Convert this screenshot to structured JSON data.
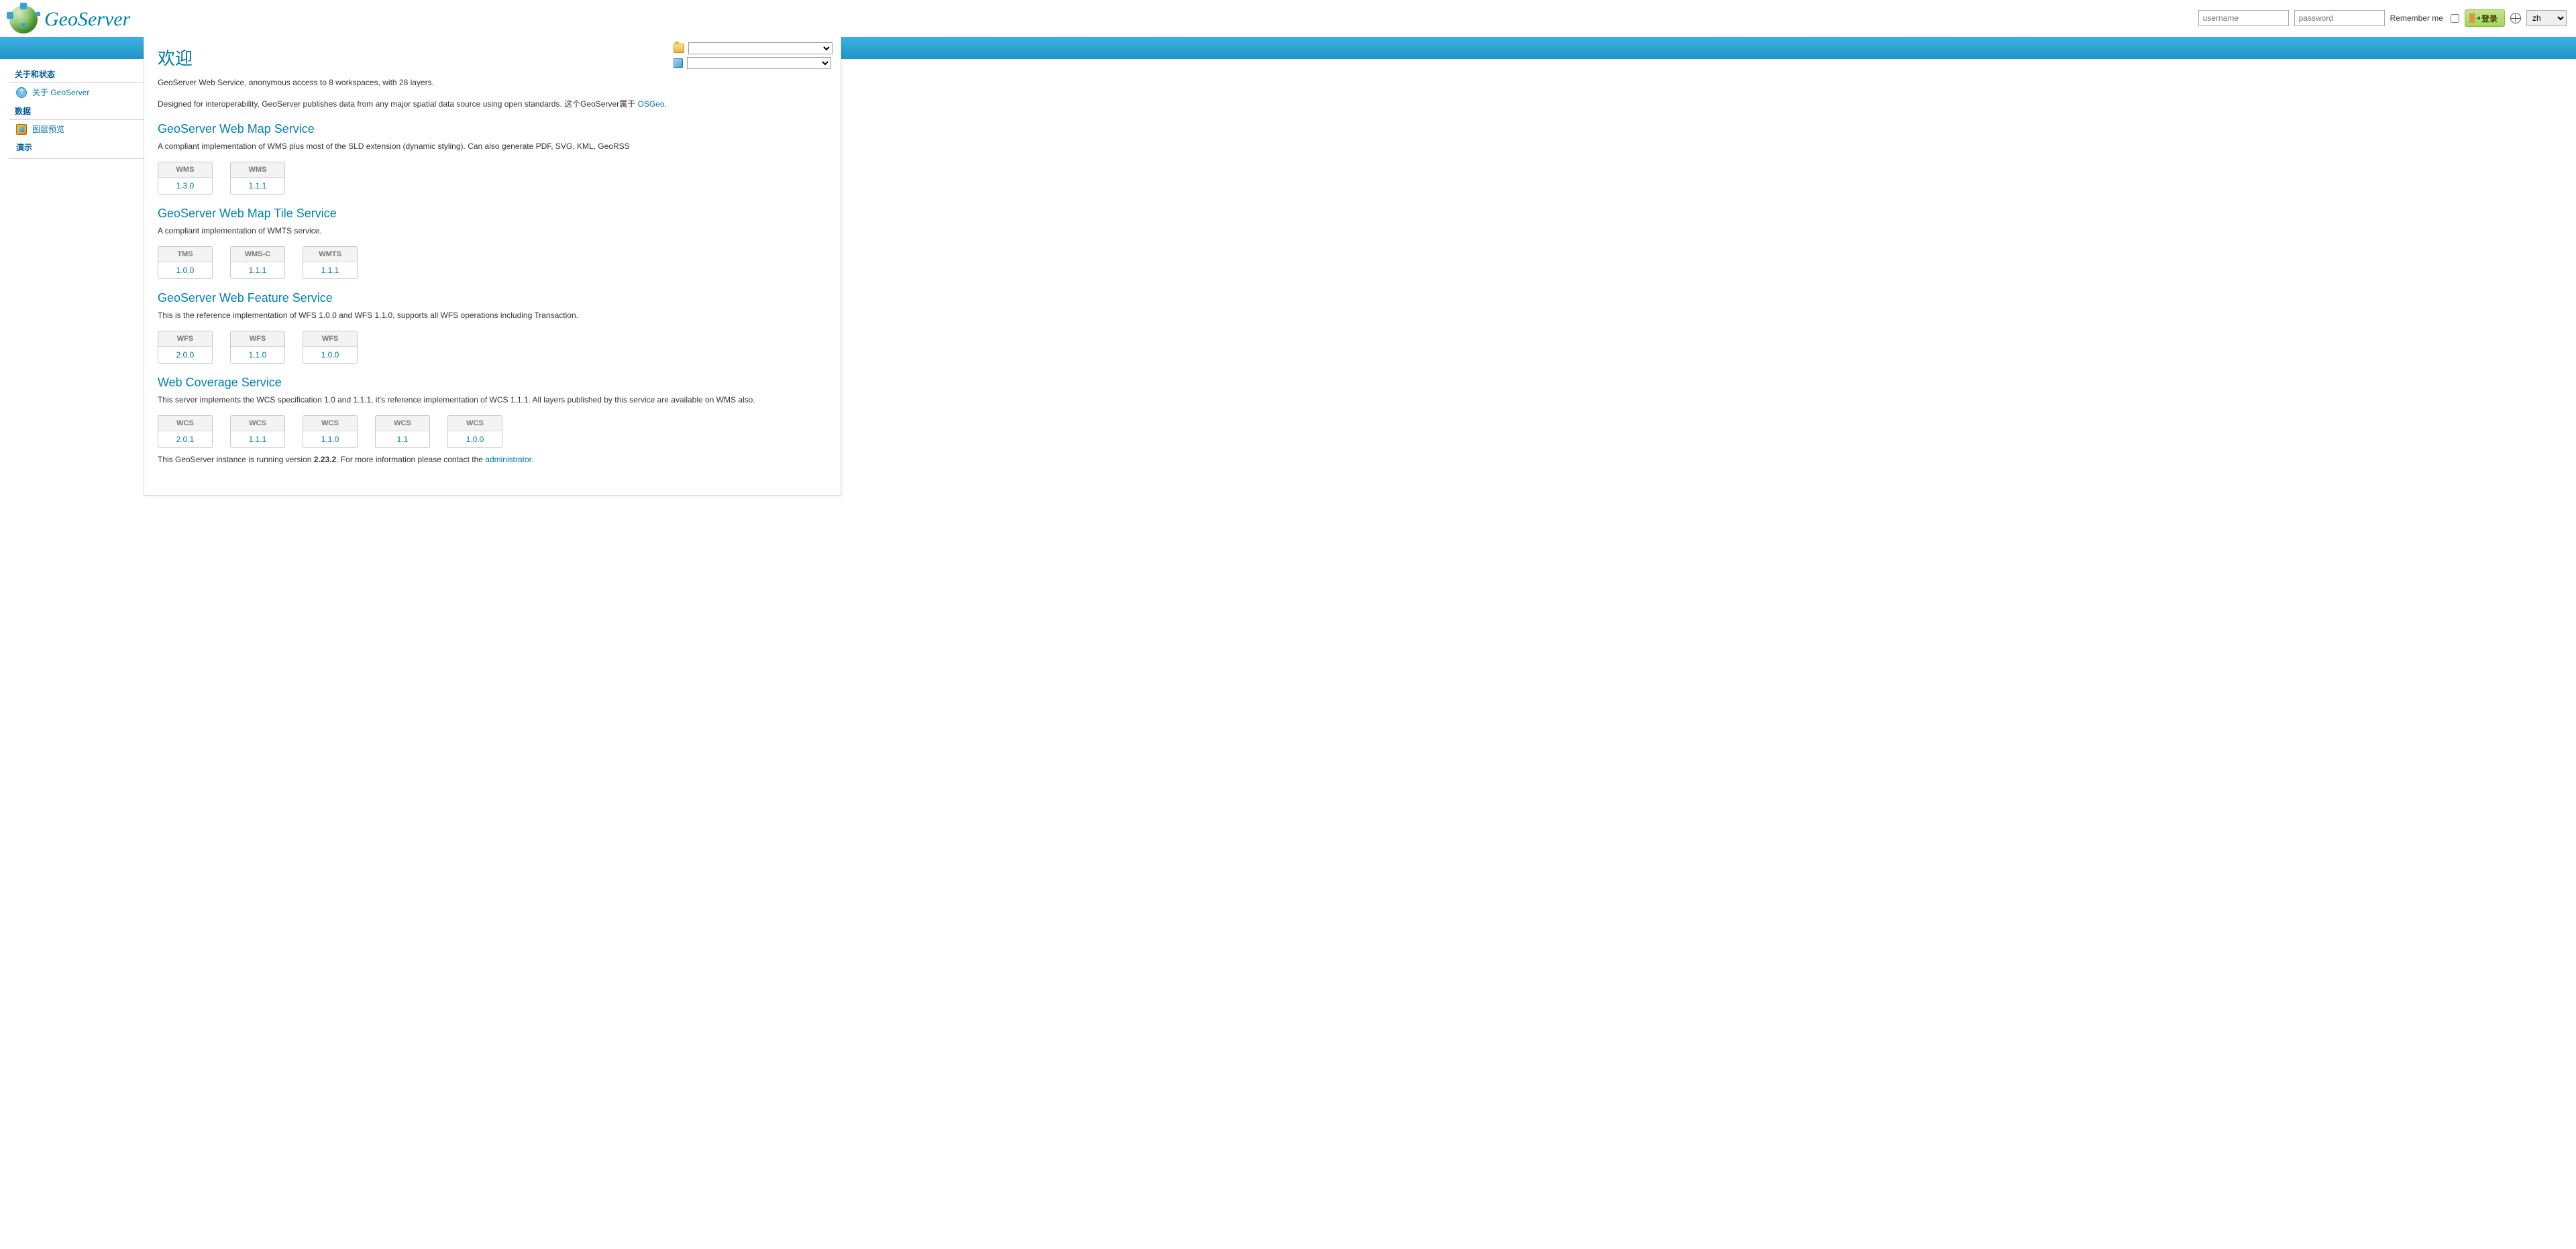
{
  "header": {
    "logo_text": "GeoServer",
    "username_placeholder": "username",
    "password_placeholder": "password",
    "remember_label": "Remember me",
    "login_button": "登录",
    "lang_value": "zh"
  },
  "sidebar": {
    "sections": [
      {
        "title": "关于和状态",
        "items": [
          {
            "label": "关于 GeoServer",
            "icon": "about"
          }
        ]
      },
      {
        "title": "数据",
        "items": [
          {
            "label": "图层预览",
            "icon": "layers"
          }
        ]
      }
    ],
    "demo_title": "演示"
  },
  "page": {
    "title": "欢迎",
    "intro": "GeoServer Web Service, anonymous access to 8 workspaces, with 28 layers.",
    "interop_1": "Designed for interoperability, GeoServer publishes data from any major spatial data source using open standards. 这个GeoServer属于 ",
    "interop_link": "OSGeo",
    "interop_2": ".",
    "footer_1": "This GeoServer instance is running version ",
    "footer_version": "2.23.2",
    "footer_2": ". For more information please contact the ",
    "footer_link": "administrator",
    "footer_3": "."
  },
  "services": [
    {
      "title": "GeoServer Web Map Service",
      "desc": "A compliant implementation of WMS plus most of the SLD extension (dynamic styling). Can also generate PDF, SVG, KML, GeoRSS",
      "tiles": [
        {
          "hd": "WMS",
          "bd": "1.3.0"
        },
        {
          "hd": "WMS",
          "bd": "1.1.1"
        }
      ]
    },
    {
      "title": "GeoServer Web Map Tile Service",
      "desc": "A compliant implementation of WMTS service.",
      "tiles": [
        {
          "hd": "TMS",
          "bd": "1.0.0"
        },
        {
          "hd": "WMS-C",
          "bd": "1.1.1"
        },
        {
          "hd": "WMTS",
          "bd": "1.1.1"
        }
      ]
    },
    {
      "title": "GeoServer Web Feature Service",
      "desc": "This is the reference implementation of WFS 1.0.0 and WFS 1.1.0, supports all WFS operations including Transaction.",
      "tiles": [
        {
          "hd": "WFS",
          "bd": "2.0.0"
        },
        {
          "hd": "WFS",
          "bd": "1.1.0"
        },
        {
          "hd": "WFS",
          "bd": "1.0.0"
        }
      ]
    },
    {
      "title": "Web Coverage Service",
      "desc": "This server implements the WCS specification 1.0 and 1.1.1, it's reference implementation of WCS 1.1.1. All layers published by this service are available on WMS also.",
      "tiles": [
        {
          "hd": "WCS",
          "bd": "2.0.1"
        },
        {
          "hd": "WCS",
          "bd": "1.1.1"
        },
        {
          "hd": "WCS",
          "bd": "1.1.0"
        },
        {
          "hd": "WCS",
          "bd": "1.1"
        },
        {
          "hd": "WCS",
          "bd": "1.0.0"
        }
      ]
    }
  ]
}
